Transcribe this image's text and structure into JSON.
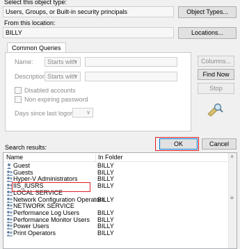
{
  "top": {
    "object_type_label": "Select this object type:",
    "object_type_value": "Users, Groups, or Built-in security principals",
    "object_types_button": "Object Types...",
    "location_label": "From this location:",
    "location_value": "BILLY",
    "locations_button": "Locations..."
  },
  "common_queries": {
    "tab_label": "Common Queries",
    "name_label": "Name:",
    "name_mode": "Starts with",
    "description_label": "Description:",
    "description_mode": "Starts with",
    "disabled_accounts": "Disabled accounts",
    "non_expiring_password": "Non expiring password",
    "days_since_logon": "Days since last logon:"
  },
  "side_buttons": {
    "columns": "Columns...",
    "find_now": "Find Now",
    "stop": "Stop"
  },
  "actions": {
    "search_results_label": "Search results:",
    "ok": "OK",
    "cancel": "Cancel"
  },
  "results": {
    "headers": {
      "name": "Name",
      "folder": "In Folder"
    },
    "rows": [
      {
        "name": "Guest",
        "folder": "BILLY",
        "icon": "user-icon"
      },
      {
        "name": "Guests",
        "folder": "BILLY",
        "icon": "group-icon"
      },
      {
        "name": "Hyper-V Administrators",
        "folder": "BILLY",
        "icon": "group-icon"
      },
      {
        "name": "IIS_IUSRS",
        "folder": "BILLY",
        "icon": "group-icon"
      },
      {
        "name": "LOCAL SERVICE",
        "folder": "",
        "icon": "group-icon"
      },
      {
        "name": "Network Configuration Operators",
        "folder": "BILLY",
        "icon": "group-icon"
      },
      {
        "name": "NETWORK SERVICE",
        "folder": "",
        "icon": "group-icon"
      },
      {
        "name": "Performance Log Users",
        "folder": "BILLY",
        "icon": "group-icon"
      },
      {
        "name": "Performance Monitor Users",
        "folder": "BILLY",
        "icon": "group-icon"
      },
      {
        "name": "Power Users",
        "folder": "BILLY",
        "icon": "group-icon"
      },
      {
        "name": "Print Operators",
        "folder": "BILLY",
        "icon": "group-icon"
      }
    ]
  },
  "colors": {
    "highlight": "#e02020",
    "accent": "#0078d7"
  }
}
